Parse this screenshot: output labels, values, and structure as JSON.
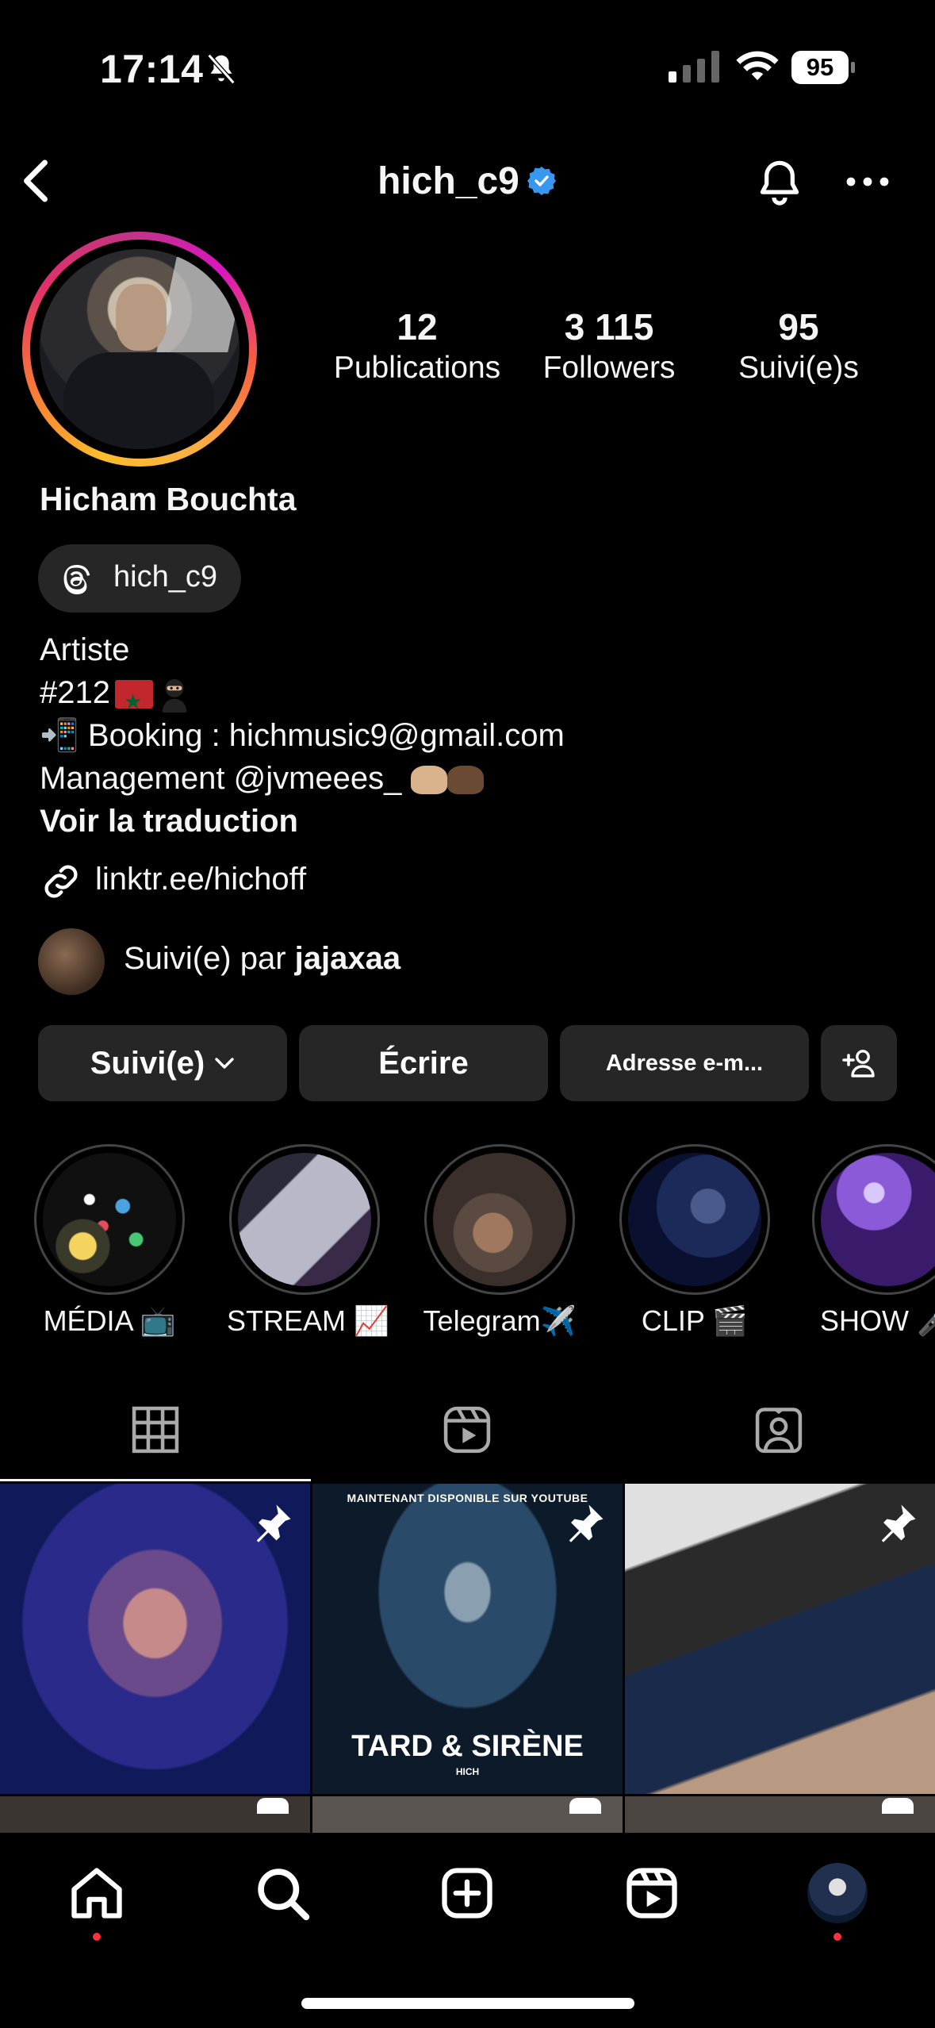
{
  "status_bar": {
    "time": "17:14",
    "battery": "95"
  },
  "header": {
    "username": "hich_c9",
    "verified": true
  },
  "stats": [
    {
      "number": "12",
      "label": "Publications"
    },
    {
      "number": "3 115",
      "label": "Followers"
    },
    {
      "number": "95",
      "label": "Suivi(e)s"
    }
  ],
  "profile": {
    "full_name": "Hicham Bouchta",
    "threads_handle": "hich_c9",
    "bio": {
      "line1": "Artiste",
      "line2": "#212",
      "line3": "📲 Booking : hichmusic9@gmail.com",
      "line4": "Management @jvmeees_",
      "translate": "Voir la traduction"
    },
    "link": "linktr.ee/hichoff",
    "followed_by_prefix": "Suivi(e) par ",
    "followed_by_name": "jajaxaa"
  },
  "buttons": {
    "following": "Suivi(e)",
    "message": "Écrire",
    "email": "Adresse e-m..."
  },
  "highlights": [
    {
      "label": "MÉDIA 📺"
    },
    {
      "label": "STREAM 📈"
    },
    {
      "label": "Telegram✈️"
    },
    {
      "label": "CLIP 🎬"
    },
    {
      "label": "SHOW 🎤"
    }
  ],
  "posts": [
    {
      "pinned": true,
      "caption_top": "",
      "caption_main": "",
      "caption_sub": ""
    },
    {
      "pinned": true,
      "caption_top": "MAINTENANT DISPONIBLE SUR YOUTUBE",
      "caption_main": "TARD & SIRÈNE",
      "caption_sub": "HICH"
    },
    {
      "pinned": true,
      "caption_top": "",
      "caption_main": "",
      "caption_sub": ""
    }
  ],
  "colors": {
    "verified_badge": "#3897f0",
    "notification_dot": "#ff3040",
    "button_bg": "#262626"
  }
}
